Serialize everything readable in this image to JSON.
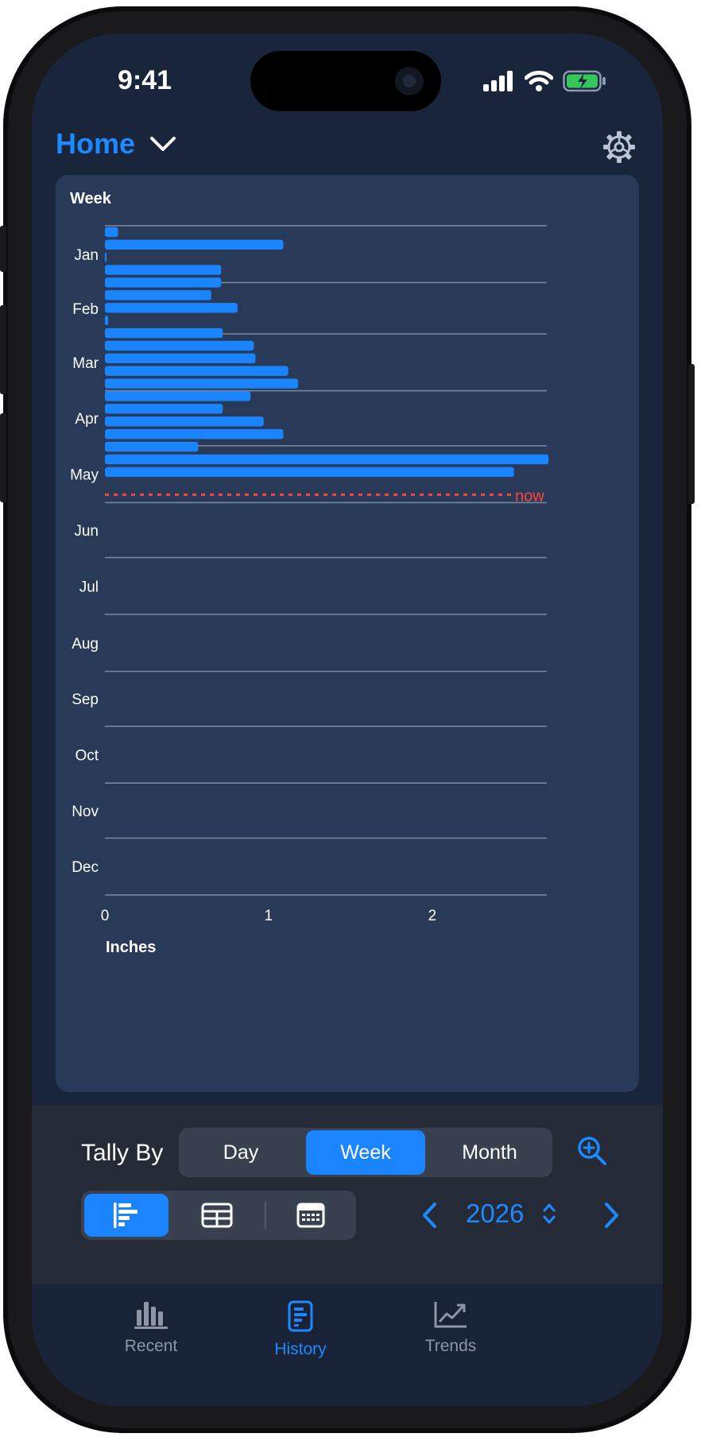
{
  "status_bar": {
    "time": "9:41"
  },
  "header": {
    "title": "Home"
  },
  "controls": {
    "tally_label": "Tally By",
    "tally_options": [
      "Day",
      "Week",
      "Month"
    ],
    "tally_selected": "Week",
    "year": "2026"
  },
  "tabbar": {
    "tabs": [
      {
        "label": "Recent",
        "active": false
      },
      {
        "label": "History",
        "active": true
      },
      {
        "label": "Trends",
        "active": false
      }
    ]
  },
  "colors": {
    "accent": "#1a85ff",
    "now_line": "#ff453a",
    "card_bg": "#283a58",
    "screen_bg": "#19253b"
  },
  "chart_data": {
    "type": "bar",
    "orientation": "horizontal",
    "title": "Week",
    "xlabel": "Inches",
    "xlim": [
      0,
      2.7
    ],
    "x_ticks": [
      0,
      1,
      2
    ],
    "y_months": [
      "Jan",
      "Feb",
      "Mar",
      "Apr",
      "May",
      "Jun",
      "Jul",
      "Aug",
      "Sep",
      "Oct",
      "Nov",
      "Dec"
    ],
    "now_label": "now",
    "now_week": 21.3,
    "weeks": [
      1,
      2,
      3,
      4,
      5,
      6,
      7,
      8,
      9,
      10,
      11,
      12,
      13,
      14,
      15,
      16,
      17,
      18,
      19,
      20,
      21
    ],
    "values": [
      0.08,
      1.09,
      0.01,
      0.71,
      0.71,
      0.65,
      0.81,
      0.02,
      0.72,
      0.91,
      0.92,
      1.12,
      1.18,
      0.89,
      0.72,
      0.97,
      1.09,
      0.57,
      2.71,
      2.5,
      0
    ],
    "grid": true
  }
}
